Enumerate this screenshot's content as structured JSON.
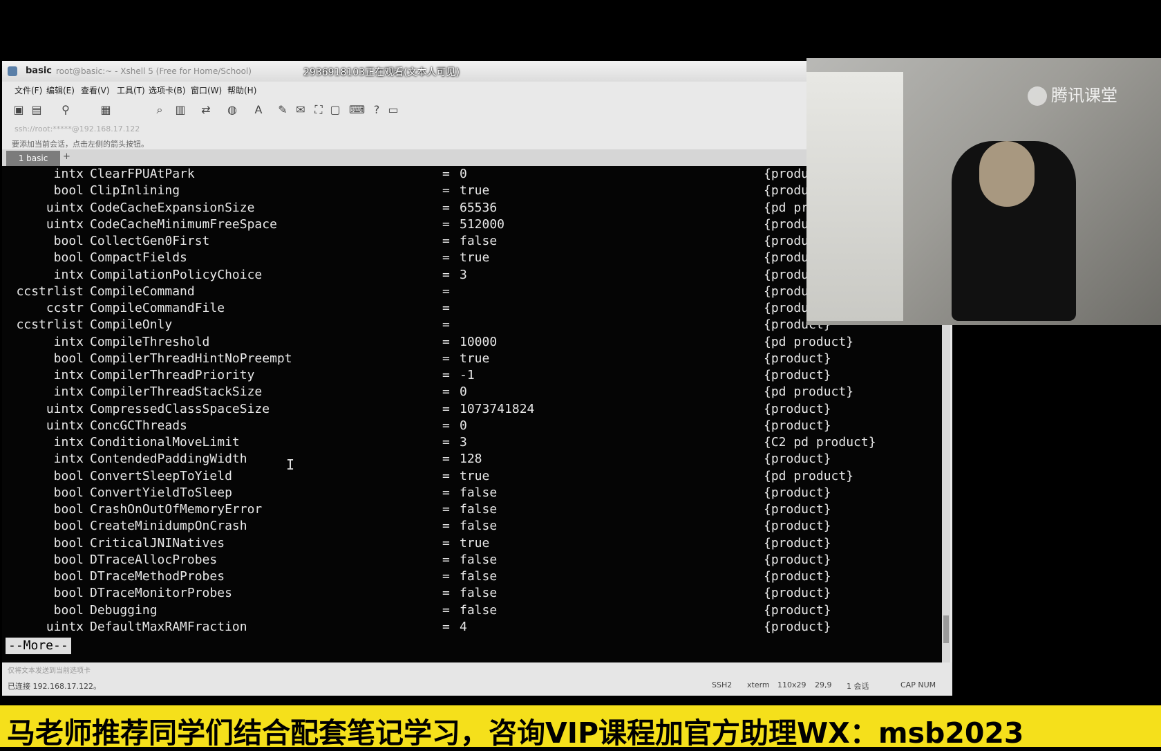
{
  "window": {
    "title_main": "basic",
    "title_sub": "root@basic:~ - Xshell 5 (Free for Home/School)",
    "viewer_notice": "2936918103正在观看(文本人可见)"
  },
  "menu": [
    "文件(F)",
    "编辑(E)",
    "查看(V)",
    "工具(T)",
    "选项卡(B)",
    "窗口(W)",
    "帮助(H)"
  ],
  "address": "ssh://root:*****@192.168.17.122",
  "hint": "要添加当前会话，点击左侧的箭头按钮。",
  "tab": {
    "label": "1 basic",
    "add": "+"
  },
  "terminal": {
    "rows": [
      {
        "type": "intx",
        "name": "ClearFPUAtPark",
        "value": "0",
        "scope": "{product}"
      },
      {
        "type": "bool",
        "name": "ClipInlining",
        "value": "true",
        "scope": "{product}"
      },
      {
        "type": "uintx",
        "name": "CodeCacheExpansionSize",
        "value": "65536",
        "scope": "{pd product}"
      },
      {
        "type": "uintx",
        "name": "CodeCacheMinimumFreeSpace",
        "value": "512000",
        "scope": "{product}"
      },
      {
        "type": "bool",
        "name": "CollectGen0First",
        "value": "false",
        "scope": "{product}"
      },
      {
        "type": "bool",
        "name": "CompactFields",
        "value": "true",
        "scope": "{product}"
      },
      {
        "type": "intx",
        "name": "CompilationPolicyChoice",
        "value": "3",
        "scope": "{product}"
      },
      {
        "type": "ccstrlist",
        "name": "CompileCommand",
        "value": "",
        "scope": "{product}"
      },
      {
        "type": "ccstr",
        "name": "CompileCommandFile",
        "value": "",
        "scope": "{product}"
      },
      {
        "type": "ccstrlist",
        "name": "CompileOnly",
        "value": "",
        "scope": "{product}"
      },
      {
        "type": "intx",
        "name": "CompileThreshold",
        "value": "10000",
        "scope": "{pd product}"
      },
      {
        "type": "bool",
        "name": "CompilerThreadHintNoPreempt",
        "value": "true",
        "scope": "{product}"
      },
      {
        "type": "intx",
        "name": "CompilerThreadPriority",
        "value": "-1",
        "scope": "{product}"
      },
      {
        "type": "intx",
        "name": "CompilerThreadStackSize",
        "value": "0",
        "scope": "{pd product}"
      },
      {
        "type": "uintx",
        "name": "CompressedClassSpaceSize",
        "value": "1073741824",
        "scope": "{product}"
      },
      {
        "type": "uintx",
        "name": "ConcGCThreads",
        "value": "0",
        "scope": "{product}"
      },
      {
        "type": "intx",
        "name": "ConditionalMoveLimit",
        "value": "3",
        "scope": "{C2 pd product}"
      },
      {
        "type": "intx",
        "name": "ContendedPaddingWidth",
        "value": "128",
        "scope": "{product}"
      },
      {
        "type": "bool",
        "name": "ConvertSleepToYield",
        "value": "true",
        "scope": "{pd product}"
      },
      {
        "type": "bool",
        "name": "ConvertYieldToSleep",
        "value": "false",
        "scope": "{product}"
      },
      {
        "type": "bool",
        "name": "CrashOnOutOfMemoryError",
        "value": "false",
        "scope": "{product}"
      },
      {
        "type": "bool",
        "name": "CreateMinidumpOnCrash",
        "value": "false",
        "scope": "{product}"
      },
      {
        "type": "bool",
        "name": "CriticalJNINatives",
        "value": "true",
        "scope": "{product}"
      },
      {
        "type": "bool",
        "name": "DTraceAllocProbes",
        "value": "false",
        "scope": "{product}"
      },
      {
        "type": "bool",
        "name": "DTraceMethodProbes",
        "value": "false",
        "scope": "{product}"
      },
      {
        "type": "bool",
        "name": "DTraceMonitorProbes",
        "value": "false",
        "scope": "{product}"
      },
      {
        "type": "bool",
        "name": "Debugging",
        "value": "false",
        "scope": "{product}"
      },
      {
        "type": "uintx",
        "name": "DefaultMaxRAMFraction",
        "value": "4",
        "scope": "{product}"
      }
    ],
    "eq": "=",
    "more": "--More--"
  },
  "status": {
    "hint": "仅将文本发送到当前选项卡",
    "connected": "已连接 192.168.17.122。",
    "proto": "SSH2",
    "term": "xterm",
    "size": "110x29",
    "pos": "29,9",
    "sessions": "1 会话",
    "caps": "CAP NUM"
  },
  "webcam": {
    "logo_text": "腾讯课堂"
  },
  "banner": {
    "text": "马老师推荐同学们结合配套笔记学习，咨询VIP课程加官方助理WX：msb2023"
  }
}
